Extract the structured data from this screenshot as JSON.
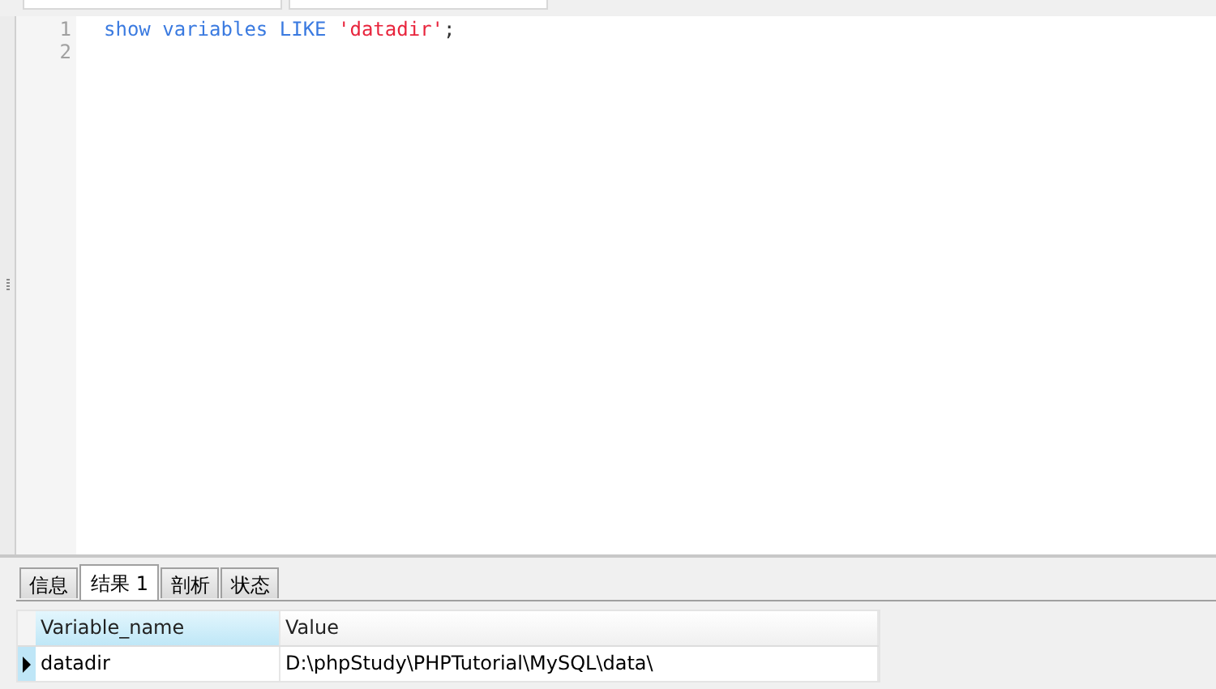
{
  "editor": {
    "lines": [
      {
        "number": "1",
        "tokens": [
          {
            "kind": "keyword",
            "text": "show variables LIKE "
          },
          {
            "kind": "string",
            "text": "'datadir'"
          },
          {
            "kind": "plain",
            "text": ";"
          }
        ]
      },
      {
        "number": "2"
      }
    ]
  },
  "result_tabs": [
    {
      "label": "信息",
      "selected": false
    },
    {
      "label": "结果 1",
      "selected": true
    },
    {
      "label": "剖析",
      "selected": false
    },
    {
      "label": "状态",
      "selected": false
    }
  ],
  "table": {
    "columns": [
      {
        "label": "Variable_name",
        "selected": true
      },
      {
        "label": "Value",
        "selected": false
      }
    ],
    "rows": [
      {
        "current": true,
        "cells": [
          "datadir",
          "D:\\phpStudy\\PHPTutorial\\MySQL\\data\\"
        ]
      }
    ]
  }
}
